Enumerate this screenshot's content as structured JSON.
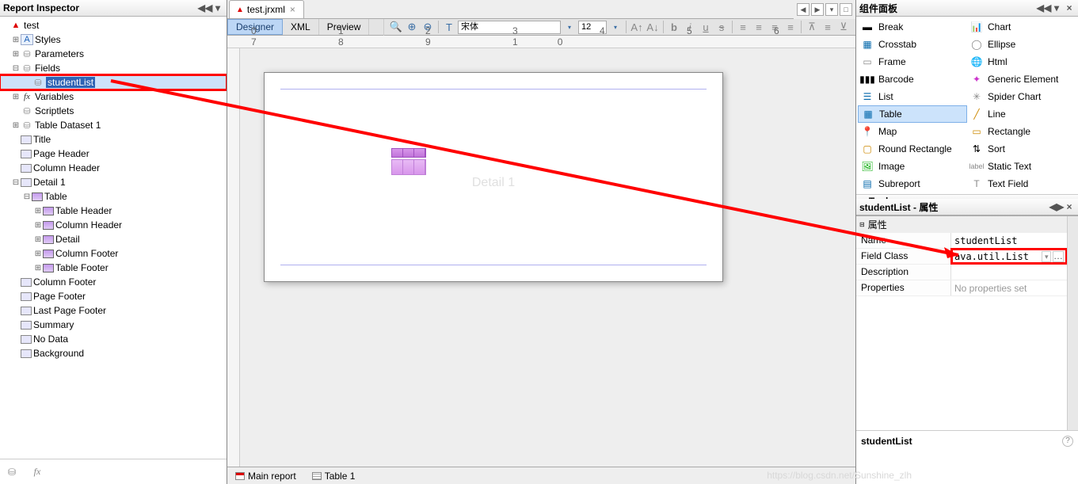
{
  "inspector": {
    "title": "Report Inspector"
  },
  "tree": {
    "root": "test",
    "styles": "Styles",
    "parameters": "Parameters",
    "fields": "Fields",
    "studentList": "studentList",
    "variables": "Variables",
    "scriptlets": "Scriptlets",
    "tableDataset": "Table Dataset 1",
    "title": "Title",
    "pageHeader": "Page Header",
    "columnHeader": "Column Header",
    "detail1": "Detail 1",
    "table": "Table",
    "tableHeader": "Table Header",
    "columnHeader2": "Column Header",
    "detail": "Detail",
    "columnFooter": "Column Footer",
    "tableFooter": "Table Footer",
    "columnFooter2": "Column Footer",
    "pageFooter": "Page Footer",
    "lastPageFooter": "Last Page Footer",
    "summary": "Summary",
    "noData": "No Data",
    "background": "Background"
  },
  "editor": {
    "filename": "test.jrxml",
    "tab_designer": "Designer",
    "tab_xml": "XML",
    "tab_preview": "Preview",
    "font": "宋体",
    "fontsize": "12",
    "detail_label": "Detail 1",
    "ruler": "0    1    2    3    4    5    6    7    8    9    10",
    "btab_main": "Main report",
    "btab_table": "Table 1"
  },
  "palette": {
    "title": "组件面板",
    "tools": "Tools",
    "items": {
      "break": "Break",
      "chart": "Chart",
      "crosstab": "Crosstab",
      "ellipse": "Ellipse",
      "frame": "Frame",
      "html": "Html",
      "barcode": "Barcode",
      "generic": "Generic Element",
      "list": "List",
      "spider": "Spider Chart",
      "table": "Table",
      "line": "Line",
      "map": "Map",
      "rectangle": "Rectangle",
      "round": "Round Rectangle",
      "sort": "Sort",
      "image": "Image",
      "static": "Static Text",
      "subreport": "Subreport",
      "textfield": "Text Field"
    }
  },
  "props": {
    "title": "studentList - 属性",
    "cat": "属性",
    "name_k": "Name",
    "name_v": "studentList",
    "class_k": "Field Class",
    "class_v": "ava.util.List",
    "desc_k": "Description",
    "desc_v": "",
    "props_k": "Properties",
    "props_v": "No properties set",
    "footer": "studentList"
  },
  "watermark": "https://blog.csdn.net/Sunshine_zlh"
}
